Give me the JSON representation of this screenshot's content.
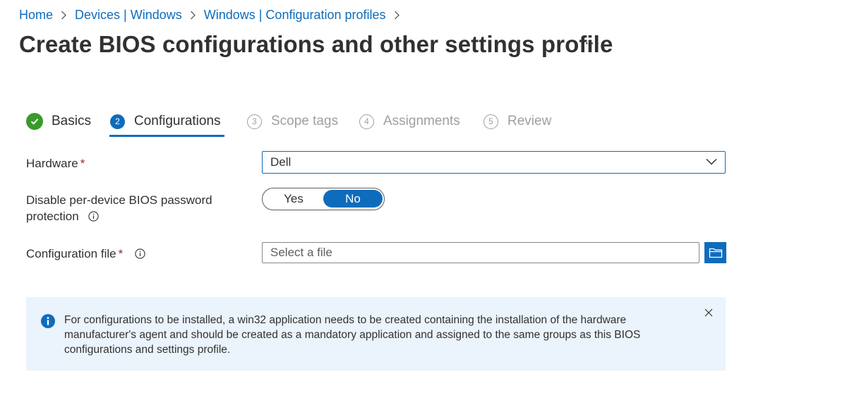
{
  "breadcrumb": [
    "Home",
    "Devices | Windows",
    "Windows | Configuration profiles"
  ],
  "page": {
    "title": "Create BIOS configurations and other settings profile",
    "more": "···"
  },
  "wizard": {
    "steps": [
      {
        "label": "Basics",
        "state": "done"
      },
      {
        "num": "2",
        "label": "Configurations",
        "state": "active"
      },
      {
        "num": "3",
        "label": "Scope tags",
        "state": "pending"
      },
      {
        "num": "4",
        "label": "Assignments",
        "state": "pending"
      },
      {
        "num": "5",
        "label": "Review",
        "state": "pending"
      }
    ]
  },
  "form": {
    "hardware": {
      "label": "Hardware",
      "required": "*",
      "value": "Dell"
    },
    "bios_password": {
      "label_line1": "Disable per-device BIOS password",
      "label_line2": "protection",
      "yes": "Yes",
      "no": "No",
      "selected": "No"
    },
    "config_file": {
      "label": "Configuration file",
      "required": "*",
      "placeholder": "Select a file"
    }
  },
  "info_bar": {
    "message": "For configurations to be installed, a win32 application needs to be created containing the installation of the hardware manufacturer's agent and should be created as a mandatory application and assigned to the same groups as this BIOS configurations and settings profile."
  },
  "icons": {
    "info": "info-icon",
    "close": "close-icon",
    "check": "checkmark-icon",
    "folder": "folder-icon",
    "chevron": "chevron-down-icon"
  },
  "colors": {
    "accent": "#0f6cbd",
    "success": "#3a9a2b",
    "required": "#a4262c",
    "info_bg": "#ebf3fc"
  }
}
